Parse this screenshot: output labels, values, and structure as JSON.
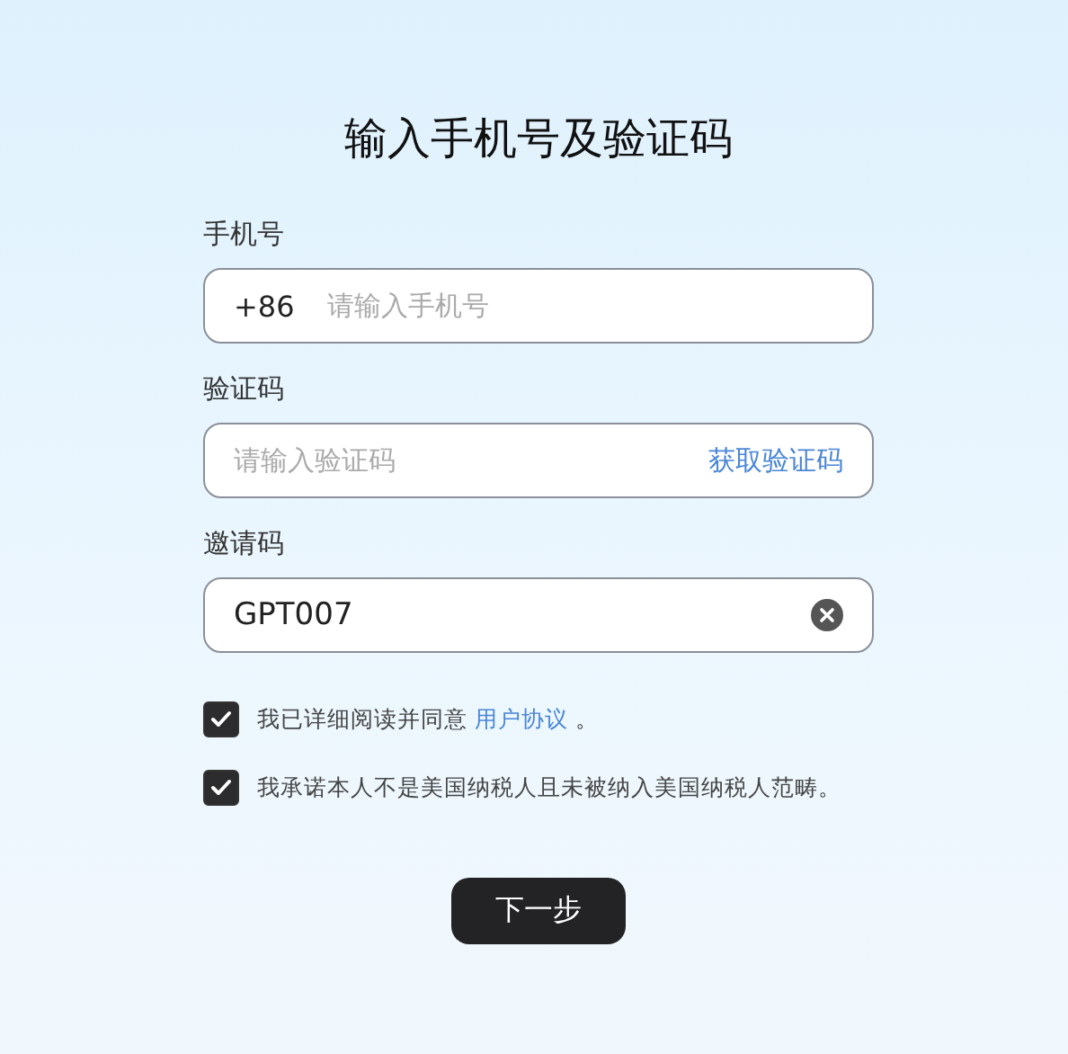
{
  "title": "输入手机号及验证码",
  "fields": [
    {
      "kind": "phone",
      "label": "手机号",
      "prefix": "+86",
      "placeholder": "请输入手机号"
    },
    {
      "kind": "code",
      "label": "验证码",
      "placeholder": "请输入验证码",
      "action": "获取验证码"
    },
    {
      "kind": "clearable",
      "label": "邀请码",
      "value": "GPT007"
    }
  ],
  "agreements": [
    {
      "checked": true,
      "text": "我已详细阅读并同意",
      "link": "用户协议",
      "after": "。"
    },
    {
      "checked": true,
      "text": "我承诺本人不是美国纳税人且未被纳入美国纳税人范畴。"
    }
  ],
  "next_button": "下一步"
}
